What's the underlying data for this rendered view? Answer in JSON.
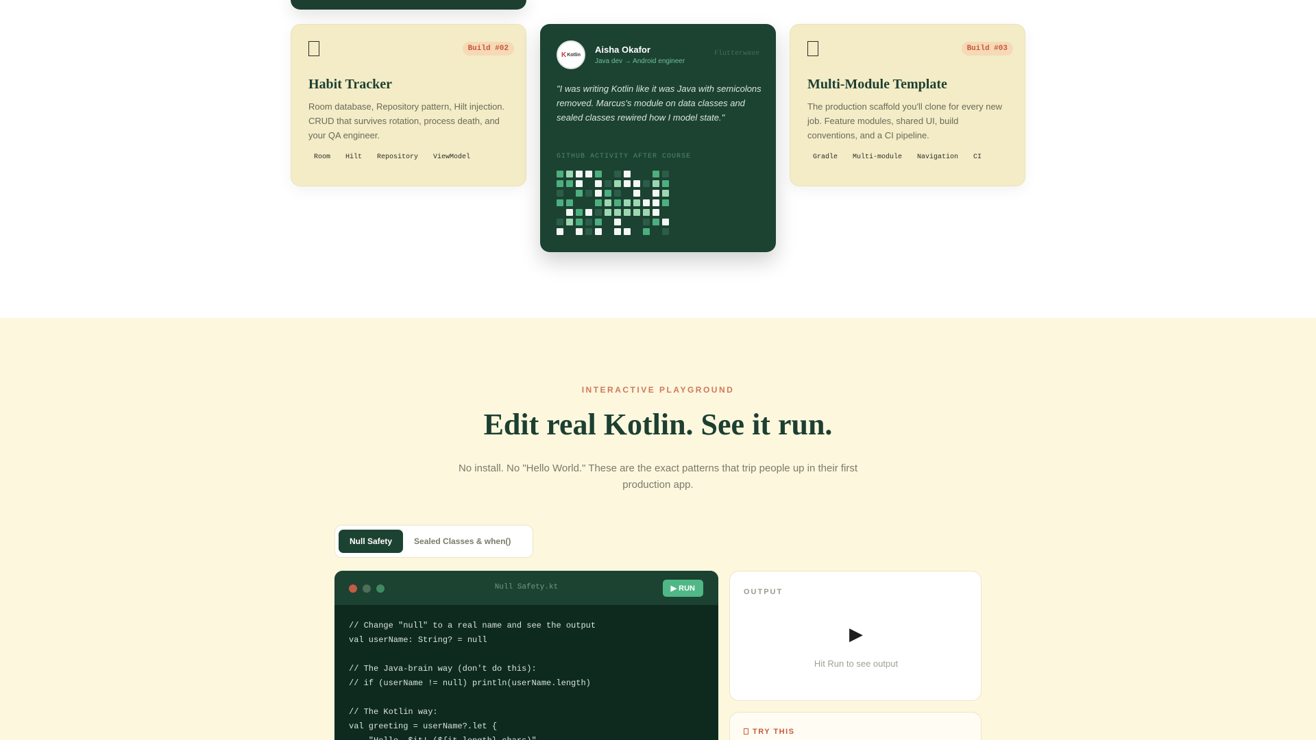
{
  "cards": [
    {
      "badge": "Build #02",
      "title": "Habit Tracker",
      "description": "Room database, Repository pattern, Hilt injection. CRUD that survives rotation, process death, and your QA engineer.",
      "tags": [
        "Room",
        "Hilt",
        "Repository",
        "ViewModel"
      ]
    },
    {
      "badge": "Build #03",
      "title": "Multi-Module Template",
      "description": "The production scaffold you'll clone for every new job. Feature modules, shared UI, build conventions, and a CI pipeline.",
      "tags": [
        "Gradle",
        "Multi-module",
        "Navigation",
        "CI"
      ]
    }
  ],
  "testimonial": {
    "avatar_mark": "K",
    "avatar_text": "Kotlin",
    "name": "Aisha Okafor",
    "role": "Java dev → Android engineer",
    "company": "Flutterwave",
    "quote": "\"I was writing Kotlin like it was Java with semicolons removed. Marcus's module on data classes and sealed classes rewired how I model state.\"",
    "activity_label": "GITHUB ACTIVITY AFTER COURSE",
    "activity": [
      [
        2,
        3,
        4,
        4,
        2,
        0,
        1,
        4,
        0,
        0,
        2,
        1
      ],
      [
        2,
        2,
        4,
        0,
        4,
        1,
        3,
        4,
        4,
        1,
        3,
        2
      ],
      [
        1,
        0,
        2,
        1,
        4,
        2,
        1,
        0,
        4,
        0,
        4,
        3
      ],
      [
        2,
        2,
        0,
        0,
        2,
        3,
        2,
        3,
        3,
        4,
        4,
        2
      ],
      [
        0,
        4,
        2,
        4,
        1,
        3,
        3,
        3,
        3,
        3,
        4,
        0
      ],
      [
        1,
        3,
        2,
        1,
        2,
        0,
        4,
        0,
        0,
        1,
        2,
        4
      ],
      [
        4,
        0,
        4,
        1,
        4,
        0,
        4,
        4,
        0,
        2,
        0,
        1
      ]
    ]
  },
  "playground": {
    "eyebrow": "INTERACTIVE PLAYGROUND",
    "headline": "Edit real Kotlin. See it run.",
    "subtitle": "No install. No \"Hello World.\" These are the exact patterns that trip people up in their first production app.",
    "tabs": [
      {
        "label": "Null Safety",
        "active": true
      },
      {
        "label": "Sealed Classes & when()",
        "active": false
      }
    ],
    "editor": {
      "filename": "Null Safety.kt",
      "run_label": "▶ RUN",
      "dot_colors": [
        "#c25c45",
        "#4d6e58",
        "#3f8a62"
      ],
      "lines": [
        "// Change \"null\" to a real name and see the output",
        "val userName: String? = null",
        "",
        "// The Java-brain way (don't do this):",
        "// if (userName != null) println(userName.length)",
        "",
        "// The Kotlin way:",
        "val greeting = userName?.let {",
        "    \"Hello, $it! (${it.length} chars)\""
      ]
    },
    "output": {
      "label": "OUTPUT",
      "play_icon": "▶",
      "hint": "Hit Run to see output"
    },
    "try_this": {
      "label": "TRY THIS"
    }
  },
  "colors": {
    "forest": "#1c4232",
    "accent_green": "#4fb886",
    "terracotta": "#c65a3a",
    "cream": "#fdf7de"
  }
}
